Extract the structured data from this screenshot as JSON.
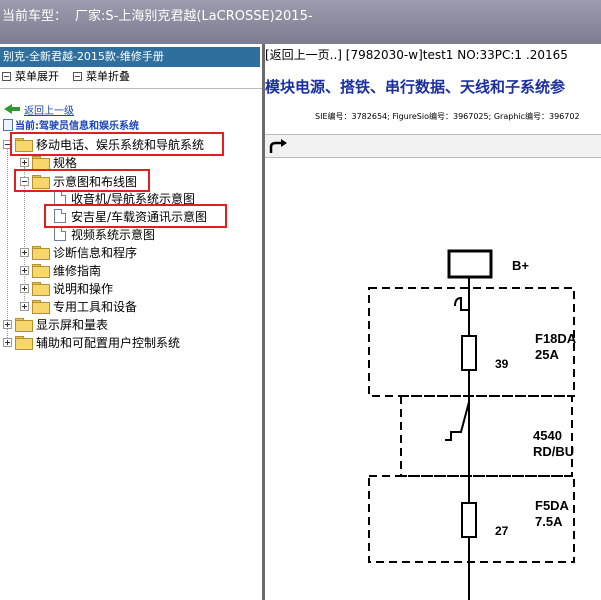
{
  "topbar": {
    "label": "当前车型：",
    "maker": "厂家:S-上海别克君越(LaCROSSE)2015-"
  },
  "left_pane": {
    "header": "别克-全新君越-2015款-维修手册",
    "menu": {
      "expand": "菜单展开",
      "collapse": "菜单折叠"
    },
    "back_link": "返回上一级",
    "current_location": "当前:驾驶员信息和娱乐系统",
    "tree": [
      {
        "label": "移动电话、娱乐系统和导航系统",
        "level": 0,
        "expander": "minus",
        "icon": "folder-open-icon",
        "highlighted": true
      },
      {
        "label": "规格",
        "level": 1,
        "expander": "plus",
        "icon": "folder-icon"
      },
      {
        "label": "示意图和布线图",
        "level": 1,
        "expander": "minus",
        "icon": "folder-open-icon",
        "highlighted": true
      },
      {
        "label": "收音机/导航系统示意图",
        "level": 2,
        "icon": "document-icon"
      },
      {
        "label": "安吉星/车载资通讯示意图",
        "level": 2,
        "icon": "document-icon",
        "highlighted": true,
        "selected": true
      },
      {
        "label": "视频系统示意图",
        "level": 2,
        "icon": "document-icon"
      },
      {
        "label": "诊断信息和程序",
        "level": 1,
        "expander": "plus",
        "icon": "folder-icon"
      },
      {
        "label": "维修指南",
        "level": 1,
        "expander": "plus",
        "icon": "folder-icon"
      },
      {
        "label": "说明和操作",
        "level": 1,
        "expander": "plus",
        "icon": "folder-icon"
      },
      {
        "label": "专用工具和设备",
        "level": 1,
        "expander": "plus",
        "icon": "folder-icon"
      },
      {
        "label": "显示屏和量表",
        "level": 0,
        "expander": "plus",
        "icon": "folder-icon"
      },
      {
        "label": "辅助和可配置用户控制系统",
        "level": 0,
        "expander": "plus",
        "icon": "folder-icon"
      }
    ]
  },
  "right_pane": {
    "nav_line": "[返回上一页..] [7982030-w]test1 NO:33PC:1 .20165",
    "title": "模块电源、搭铁、串行数据、天线和子系统参",
    "meta": "SIE编号：3782654;  FigureSio编号：3967025;  Graphic编号：396702",
    "schematic": {
      "battery_label": "B+",
      "fuse1_name": "F18DA",
      "fuse1_rating": "25A",
      "fuse1_pin": "39",
      "wire_circuit": "4540",
      "wire_color": "RD/BU",
      "fuse2_name": "F5DA",
      "fuse2_rating": "7.5A",
      "fuse2_pin": "27"
    }
  },
  "colors": {
    "topbar": "#8a8a9e",
    "header_blue": "#2e6f9e",
    "link_blue": "#1a43b8",
    "title_blue": "#1b2fa3",
    "highlight_red": "#e02020"
  }
}
